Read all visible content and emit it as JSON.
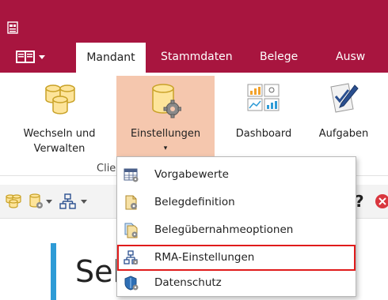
{
  "tabs": [
    {
      "label": "Mandant",
      "active": true
    },
    {
      "label": "Stammdaten",
      "active": false
    },
    {
      "label": "Belege",
      "active": false
    },
    {
      "label": "Ausw",
      "active": false
    }
  ],
  "ribbon": {
    "buttons": [
      {
        "line1": "Wechseln und",
        "line2": "Verwalten",
        "icon": "database-stack-icon"
      },
      {
        "line1": "Einstellungen",
        "line2": "▾",
        "icon": "database-gear-icon",
        "selected": true
      },
      {
        "line1": "Dashboard",
        "line2": "",
        "icon": "dashboard-icon"
      },
      {
        "line1": "Aufgaben",
        "line2": "",
        "icon": "checklist-pen-icon"
      }
    ],
    "group_label": "Clie"
  },
  "qat": {
    "help_label": "?"
  },
  "content": {
    "heading": "Sel"
  },
  "dropdown": {
    "items": [
      {
        "label": "Vorgabewerte",
        "icon": "table-settings-icon"
      },
      {
        "label": "Belegdefinition",
        "icon": "document-gear-icon"
      },
      {
        "label": "Belegübernahmeoptionen",
        "icon": "document-transfer-gear-icon"
      },
      {
        "label": "RMA-Einstellungen",
        "icon": "network-gear-icon",
        "highlighted": true
      },
      {
        "label": "Datenschutz",
        "icon": "shield-gear-icon"
      }
    ]
  },
  "colors": {
    "brand": "#a8153f",
    "selected_button": "#f5c7ae",
    "highlight_outline": "#e01b1b",
    "accent_bar": "#2e9bd6"
  }
}
